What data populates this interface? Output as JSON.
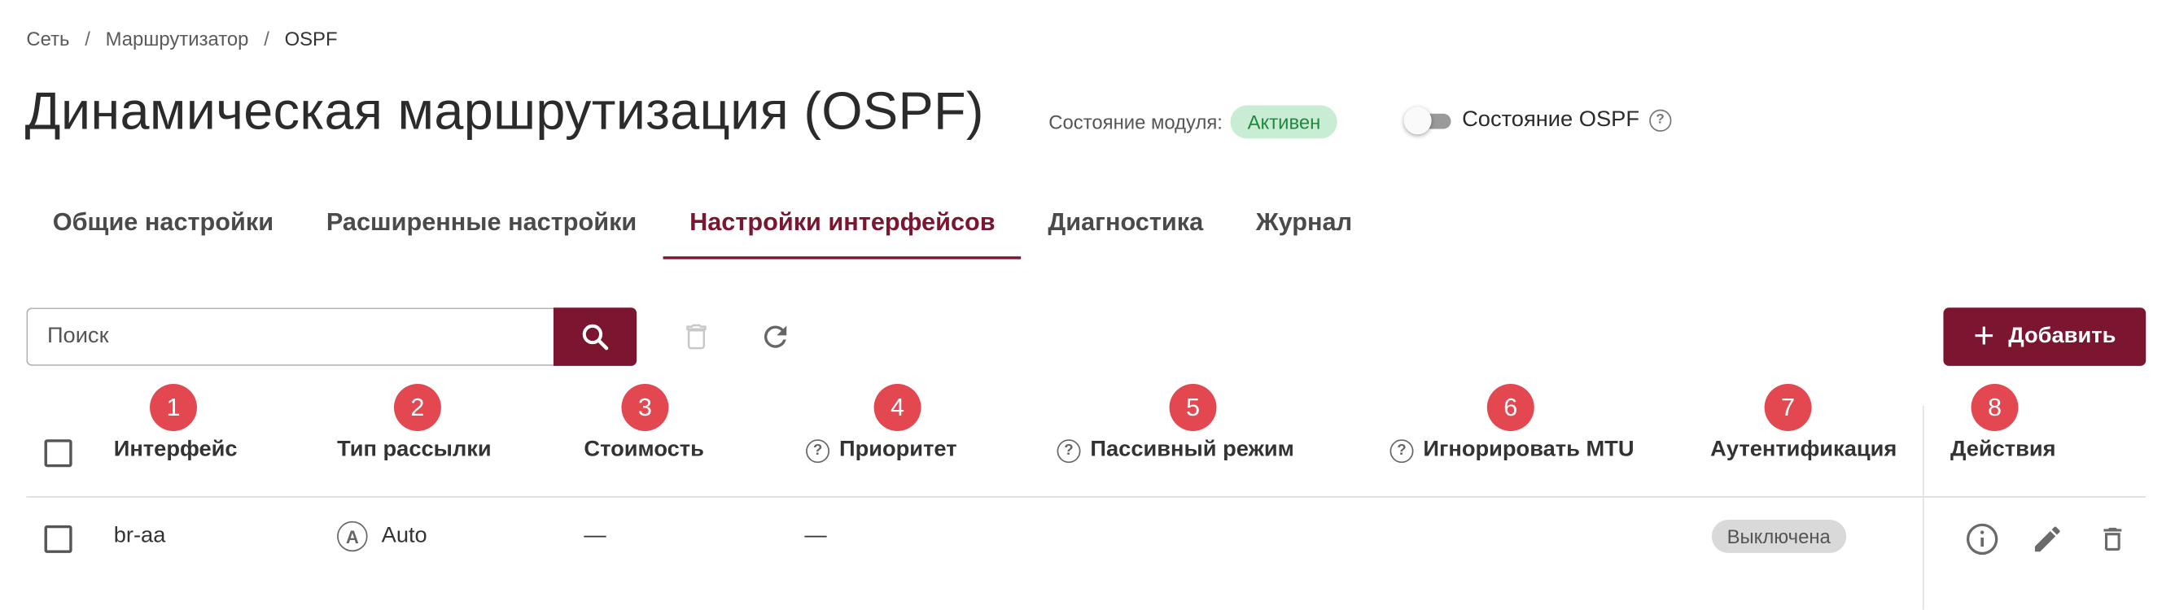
{
  "breadcrumb": {
    "items": [
      "Сеть",
      "Маршрутизатор",
      "OSPF"
    ],
    "separator": "/"
  },
  "header": {
    "title": "Динамическая маршрутизация (OSPF)",
    "module_state_label": "Состояние модуля:",
    "module_state_value": "Активен",
    "ospf_state_label": "Состояние OSPF",
    "ospf_state_on": false,
    "help_glyph": "?"
  },
  "tabs": [
    {
      "label": "Общие настройки",
      "active": false
    },
    {
      "label": "Расширенные настройки",
      "active": false
    },
    {
      "label": "Настройки интерфейсов",
      "active": true
    },
    {
      "label": "Диагностика",
      "active": false
    },
    {
      "label": "Журнал",
      "active": false
    }
  ],
  "toolbar": {
    "search_placeholder": "Поиск",
    "search_icon": "search-icon",
    "delete_icon": "trash-icon",
    "refresh_icon": "refresh-icon",
    "add_plus": "+",
    "add_label": "Добавить"
  },
  "table": {
    "markers": [
      "1",
      "2",
      "3",
      "4",
      "5",
      "6",
      "7",
      "8"
    ],
    "columns": [
      {
        "label": "Интерфейс",
        "help": false
      },
      {
        "label": "Тип рассылки",
        "help": false
      },
      {
        "label": "Стоимость",
        "help": false
      },
      {
        "label": "Приоритет",
        "help": true
      },
      {
        "label": "Пассивный режим",
        "help": true
      },
      {
        "label": "Игнорировать MTU",
        "help": true
      },
      {
        "label": "Аутентификация",
        "help": false
      },
      {
        "label": "Действия",
        "help": false
      }
    ],
    "rows": [
      {
        "interface": "br-aa",
        "broadcast_icon_letter": "A",
        "broadcast_type": "Auto",
        "cost": "—",
        "priority": "—",
        "passive": "",
        "ignore_mtu": "",
        "auth": "Выключена",
        "actions": [
          "info-icon",
          "edit-icon",
          "trash-icon"
        ]
      }
    ]
  },
  "colors": {
    "brand": "#7b1530",
    "marker": "#e3474f",
    "active_badge_bg": "#c9ecd4",
    "active_badge_text": "#1f8a3d",
    "disabled_badge_bg": "#d9d9d9"
  }
}
